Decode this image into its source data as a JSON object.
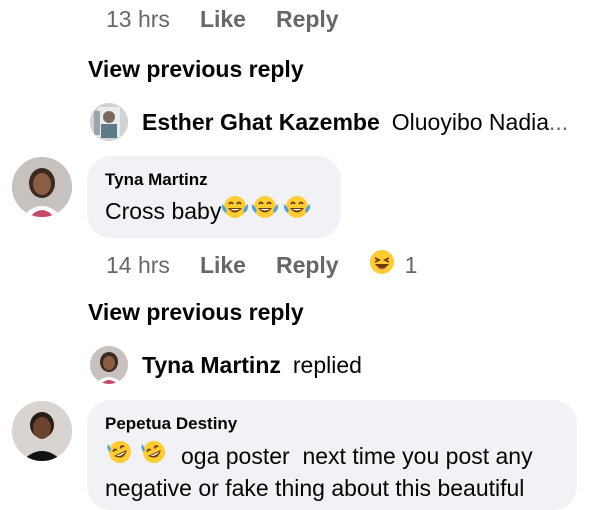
{
  "top_row": {
    "time": "13 hrs",
    "like_label": "Like",
    "reply_label": "Reply"
  },
  "view_previous_1": "View previous reply",
  "reply_summary_1": {
    "name": "Esther Ghat Kazembe",
    "preview": "Oluoyibo Nadia",
    "ellipsis": "..."
  },
  "comment_1": {
    "author": "Tyna Martinz",
    "text": "Cross baby",
    "emoji": "face-with-tears-of-joy-icon",
    "time": "14 hrs",
    "like_label": "Like",
    "reply_label": "Reply",
    "reaction_icon": "laughing-face-icon",
    "reaction_count": "1"
  },
  "view_previous_2": "View previous reply",
  "reply_summary_2": {
    "name": "Tyna Martinz",
    "preview": "replied"
  },
  "comment_2": {
    "author": "Pepetua Destiny",
    "text_line1": "oga poster  next time you post any",
    "text_line2": "negative or fake thing about this beautiful",
    "emoji": "rolling-on-the-floor-laughing-icon"
  },
  "colors": {
    "bubble_bg": "#f0f2f5",
    "meta_gray": "#65676b",
    "emoji_yellow": "#ffcc33",
    "tear_blue": "#4aa3e0"
  }
}
